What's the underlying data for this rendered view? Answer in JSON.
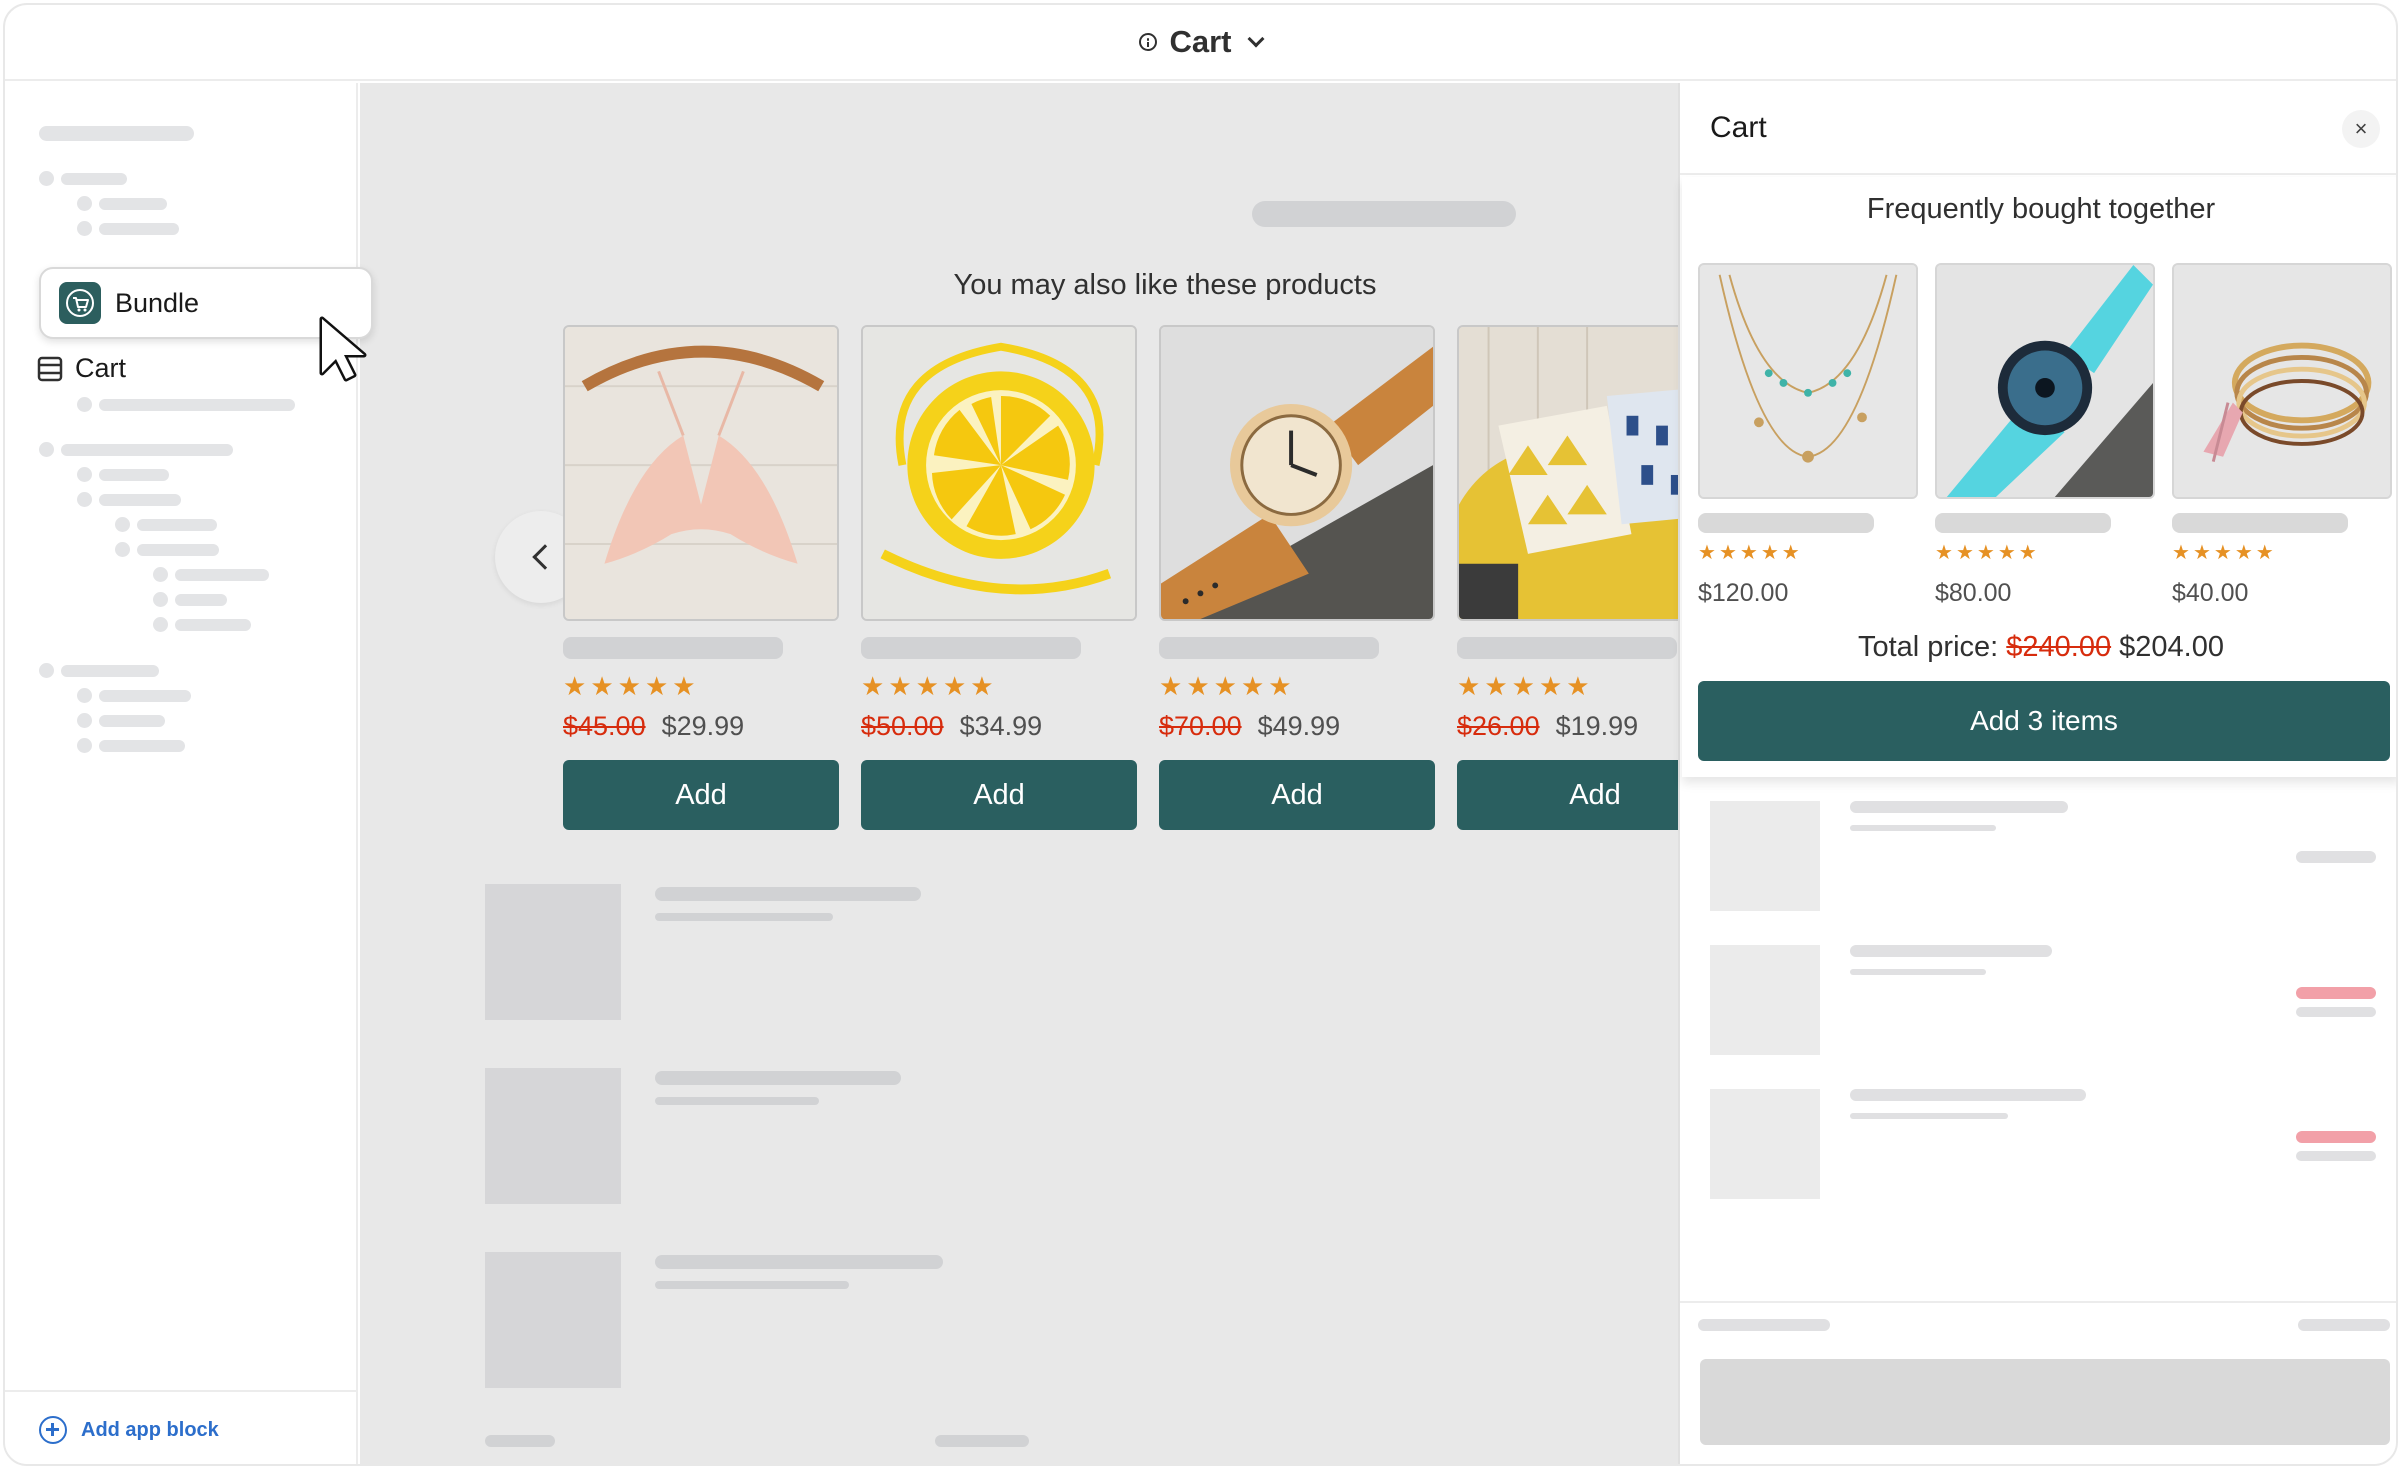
{
  "topbar": {
    "title": "Cart"
  },
  "sidebar": {
    "bundle_label": "Bundle",
    "cart_label": "Cart",
    "add_block_label": "Add app block"
  },
  "main": {
    "recommendations_title": "You may also like these products",
    "products": [
      {
        "image": "lace-bralette",
        "rating": 5,
        "old_price": "$45.00",
        "price": "$29.99",
        "button": "Add"
      },
      {
        "image": "lemon-bag",
        "rating": 5,
        "old_price": "$50.00",
        "price": "$34.99",
        "button": "Add"
      },
      {
        "image": "wooden-watch",
        "rating": 5,
        "old_price": "$70.00",
        "price": "$49.99",
        "button": "Add"
      },
      {
        "image": "yellow-armchair",
        "rating": 5,
        "old_price": "$26.00",
        "price": "$19.99",
        "button": "Add"
      }
    ]
  },
  "cart_panel": {
    "title": "Cart",
    "close_icon": "×",
    "bundle": {
      "title": "Frequently bought together",
      "items": [
        {
          "image": "turquoise-necklace",
          "rating": 5,
          "price": "$120.00"
        },
        {
          "image": "blue-watch",
          "rating": 5,
          "price": "$80.00"
        },
        {
          "image": "bracelets",
          "rating": 5,
          "price": "$40.00"
        }
      ],
      "total_label": "Total price:",
      "total_old": "$240.00",
      "total_new": "$204.00",
      "button": "Add 3 items"
    }
  },
  "colors": {
    "accent": "#2a5f60",
    "sale": "#d72c0d",
    "star": "#e69124",
    "link": "#2c6ecb"
  }
}
